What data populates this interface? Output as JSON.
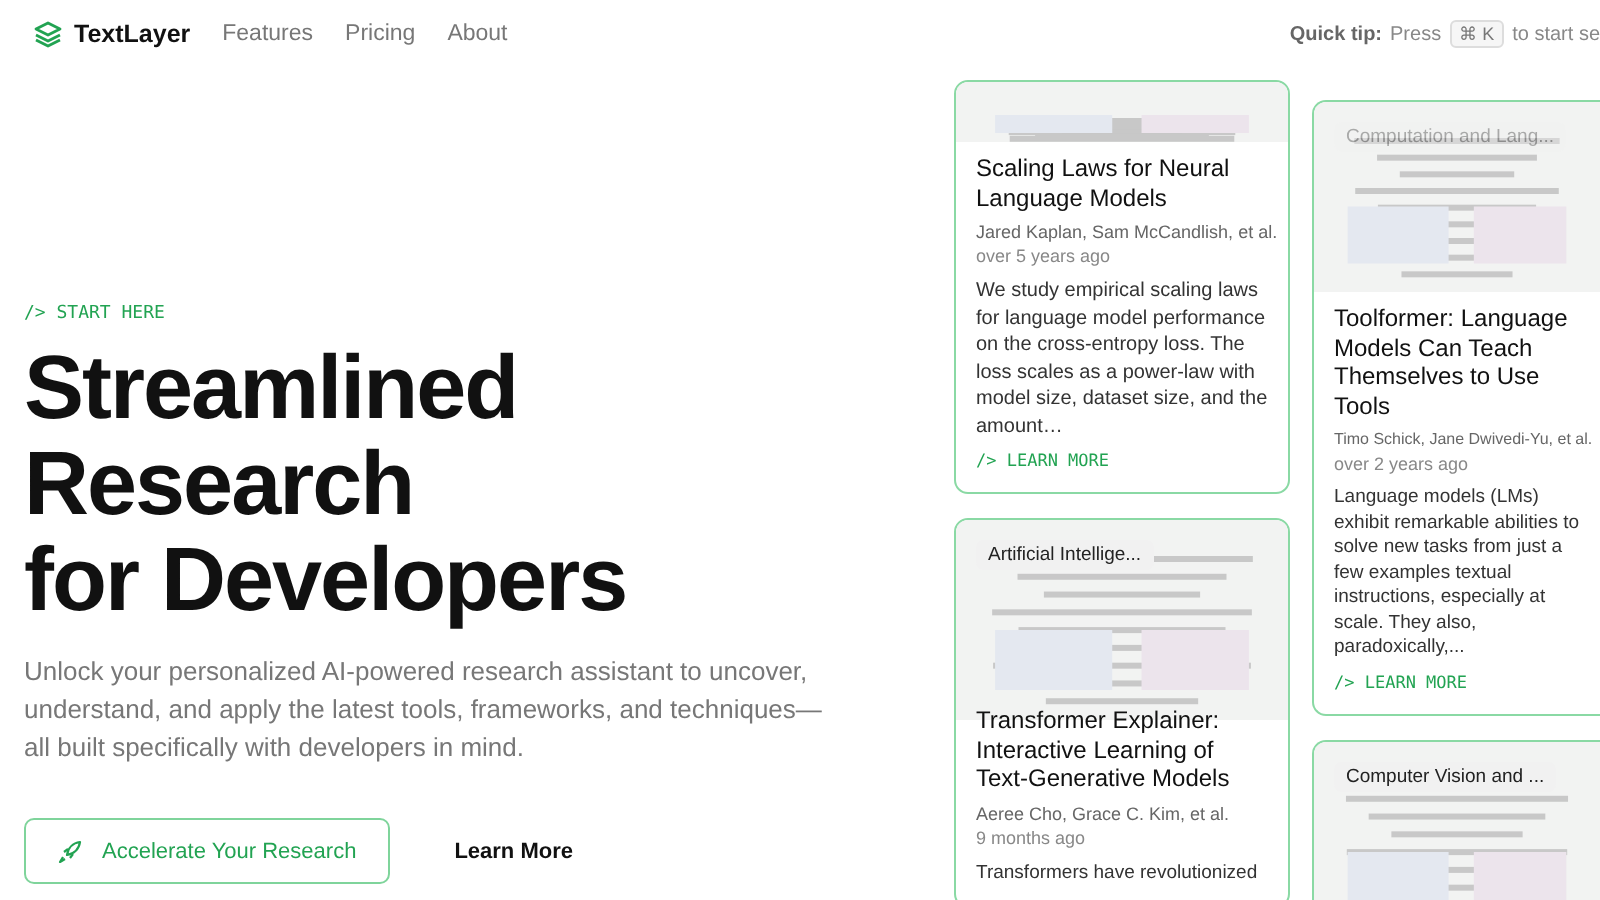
{
  "navbar": {
    "brand": "TextLayer",
    "links": [
      "Features",
      "Pricing",
      "About"
    ],
    "quick_tip": {
      "label": "Quick tip:",
      "prefix": "Press",
      "key": "⌘ K",
      "suffix": "to start se"
    }
  },
  "hero": {
    "eyebrow": "/> START HERE",
    "heading": [
      "Streamlined",
      "Research",
      "for Developers"
    ],
    "description": "Unlock your personalized AI-powered research assistant to uncover, understand, and apply the latest tools, frameworks, and techniques—all built specifically with developers in mind.",
    "primary_button": "Accelerate Your Research",
    "secondary_button": "Learn More"
  },
  "columns": [
    [
      {
        "title": "Scaling Laws for Neural Language Models",
        "authors": "Jared Kaplan, Sam McCandlish, et al.",
        "age": "over 5 years ago",
        "abstract": "We study empirical scaling laws for language model performance on the cross-entropy loss. The loss scales as a power-law with model size, dataset size, and the amount…",
        "link": "/> LEARN MORE"
      },
      {
        "tag": "Artificial Intellige...",
        "title": "Transformer Explainer: Interactive Learning of Text-Generative Models",
        "authors": "Aeree Cho, Grace C. Kim, et al.",
        "age": "9 months ago",
        "abstract": "Transformers have revolutionized"
      }
    ],
    [
      {
        "tag": "Computation and Lang...",
        "title": "Toolformer: Language Models Can Teach Themselves to Use Tools",
        "authors": "Timo Schick, Jane Dwivedi-Yu, et al.",
        "age": "over 2 years ago",
        "abstract": "Language models (LMs) exhibit remarkable abilities to solve new tasks from just a few examples textual instructions, especially at scale. They also, paradoxically,...",
        "link": "/> LEARN MORE"
      },
      {
        "tag": "Computer Vision and ..."
      }
    ]
  ]
}
